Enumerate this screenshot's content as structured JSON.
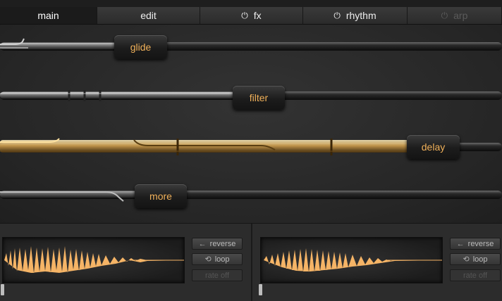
{
  "tabs": [
    {
      "label": "main",
      "power": false,
      "state": "active"
    },
    {
      "label": "edit",
      "power": false,
      "state": "normal"
    },
    {
      "label": "fx",
      "power": true,
      "state": "normal"
    },
    {
      "label": "rhythm",
      "power": true,
      "state": "normal"
    },
    {
      "label": "arp",
      "power": true,
      "state": "disabled"
    }
  ],
  "power_glyph": "⏻",
  "controls": {
    "glide": {
      "label": "glide"
    },
    "filter": {
      "label": "filter"
    },
    "delay": {
      "label": "delay"
    },
    "more": {
      "label": "more"
    }
  },
  "sample_slots": [
    {
      "reverse": "reverse",
      "loop": "loop",
      "rate": "rate off"
    },
    {
      "reverse": "reverse",
      "loop": "loop",
      "rate": "rate off"
    }
  ],
  "icons": {
    "reverse": "←",
    "loop": "⟲"
  },
  "colors": {
    "accent": "#f1b15a",
    "rod_gold": "#d9a650",
    "waveform": "#f5b466"
  }
}
